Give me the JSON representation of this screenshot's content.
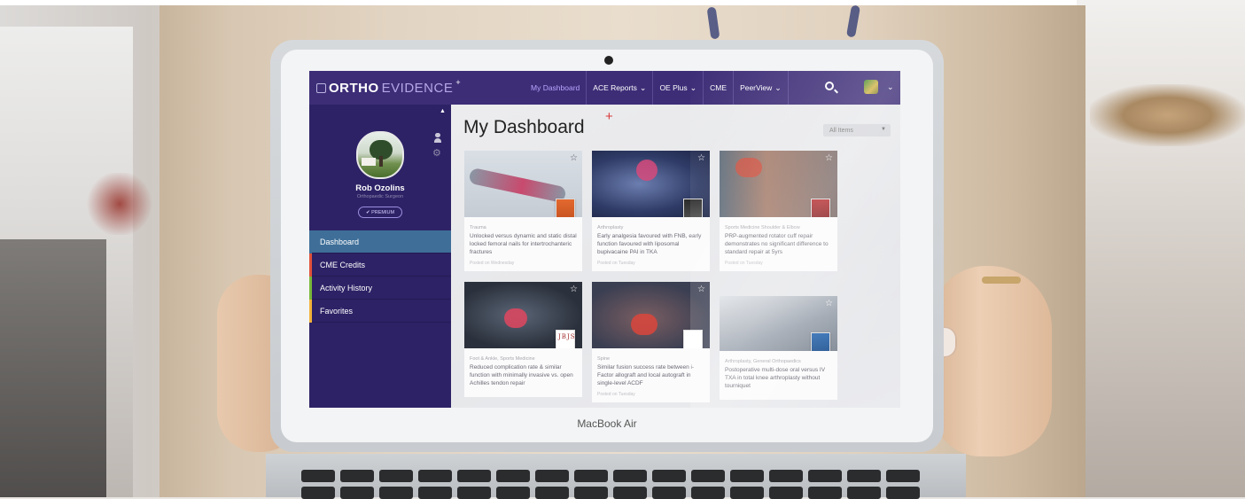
{
  "laptop": {
    "brand_label": "MacBook Air"
  },
  "app": {
    "logo": {
      "part1": "ORTHO",
      "part2": "EVIDENCE",
      "plus": "+"
    },
    "nav": {
      "items": [
        {
          "label": "My Dashboard",
          "active": true,
          "has_dropdown": false
        },
        {
          "label": "ACE Reports",
          "active": false,
          "has_dropdown": true
        },
        {
          "label": "OE Plus",
          "active": false,
          "has_dropdown": true
        },
        {
          "label": "CME",
          "active": false,
          "has_dropdown": false
        },
        {
          "label": "PeerView",
          "active": false,
          "has_dropdown": true
        }
      ],
      "chevron": "⌄",
      "search_icon": "search-icon",
      "account_icon": "avatar"
    },
    "sidebar": {
      "user_name": "Rob Ozolins",
      "user_role": "Orthopaedic Surgeon",
      "badge": "✔ PREMIUM",
      "menu": [
        {
          "label": "Dashboard",
          "active": true,
          "accent": "#3f6f99"
        },
        {
          "label": "CME Credits",
          "active": false,
          "accent": "#e0523b"
        },
        {
          "label": "Activity History",
          "active": false,
          "accent": "#79b83a"
        },
        {
          "label": "Favorites",
          "active": false,
          "accent": "#f2b33a"
        }
      ]
    },
    "main": {
      "title": "My Dashboard",
      "title_plus": "+",
      "filter": "All Items",
      "cards": [
        {
          "category": "Trauma",
          "text": "Unlocked versus dynamic and static distal locked femoral nails for intertrochanteric fractures",
          "footer": "Posted on Wednesday"
        },
        {
          "category": "Arthroplasty",
          "text": "Early analgesia favoured with FNB, early function favoured with liposomal bupivacaine PAI in TKA",
          "footer": "Posted on Tuesday"
        },
        {
          "category": "Sports Medicine Shoulder & Elbow",
          "text": "PRP-augmented rotator cuff repair demonstrates no significant difference to standard repair at 5yrs",
          "footer": "Posted on Tuesday"
        },
        {
          "category": "Foot & Ankle, Sports Medicine",
          "text": "Reduced complication rate & similar function with minimally invasive vs. open Achilles tendon repair",
          "footer": ""
        },
        {
          "category": "Spine",
          "text": "Similar fusion success rate between i-Factor allograft and local autograft in single-level ACDF",
          "footer": "Posted on Tuesday"
        },
        {
          "category": "Arthroplasty, General Orthopaedics",
          "text": "Postoperative multi-dose oral versus IV TXA in total knee arthroplasty without tourniquet",
          "footer": ""
        }
      ],
      "journal_label": "JBJS"
    }
  }
}
